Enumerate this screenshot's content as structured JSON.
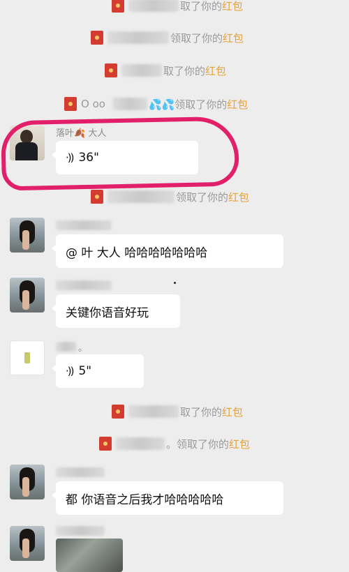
{
  "notices": [
    {
      "id": "n1",
      "before": "",
      "after": "取了你的",
      "highlight": "红包"
    },
    {
      "id": "n2",
      "before": "",
      "after": "领取了你的",
      "highlight": "红包"
    },
    {
      "id": "n3",
      "before": "",
      "after": "取了你的",
      "highlight": "红包"
    },
    {
      "id": "n4",
      "before": "O  oo",
      "after": "💦💦领取了你的",
      "highlight": "红包"
    },
    {
      "id": "n5",
      "before": "",
      "after": "领取了你的",
      "highlight": "红包"
    },
    {
      "id": "n6",
      "before": "",
      "after": "取了你的",
      "highlight": "红包"
    },
    {
      "id": "n7",
      "before": "",
      "after": "。领取了你的",
      "highlight": "红包"
    }
  ],
  "messages": [
    {
      "id": "m1",
      "nickname": "落叶🍂 大人",
      "voice_duration": "36\""
    },
    {
      "id": "m2",
      "text": "@  叶      大人  哈哈哈哈哈哈哈"
    },
    {
      "id": "m3",
      "text": "关键你语音好玩"
    },
    {
      "id": "m4",
      "nickname": "。",
      "voice_duration": "5\""
    },
    {
      "id": "m5",
      "text": "都   你语音之后我才哈哈哈哈哈"
    }
  ],
  "colors": {
    "background": "#ededed",
    "highlight": "#e6a23c",
    "annotation": "#e2206a",
    "redpacket": "#d33c2f"
  },
  "icons": {
    "redpacket": "red-packet-icon",
    "voice": "voice-wave-icon"
  }
}
